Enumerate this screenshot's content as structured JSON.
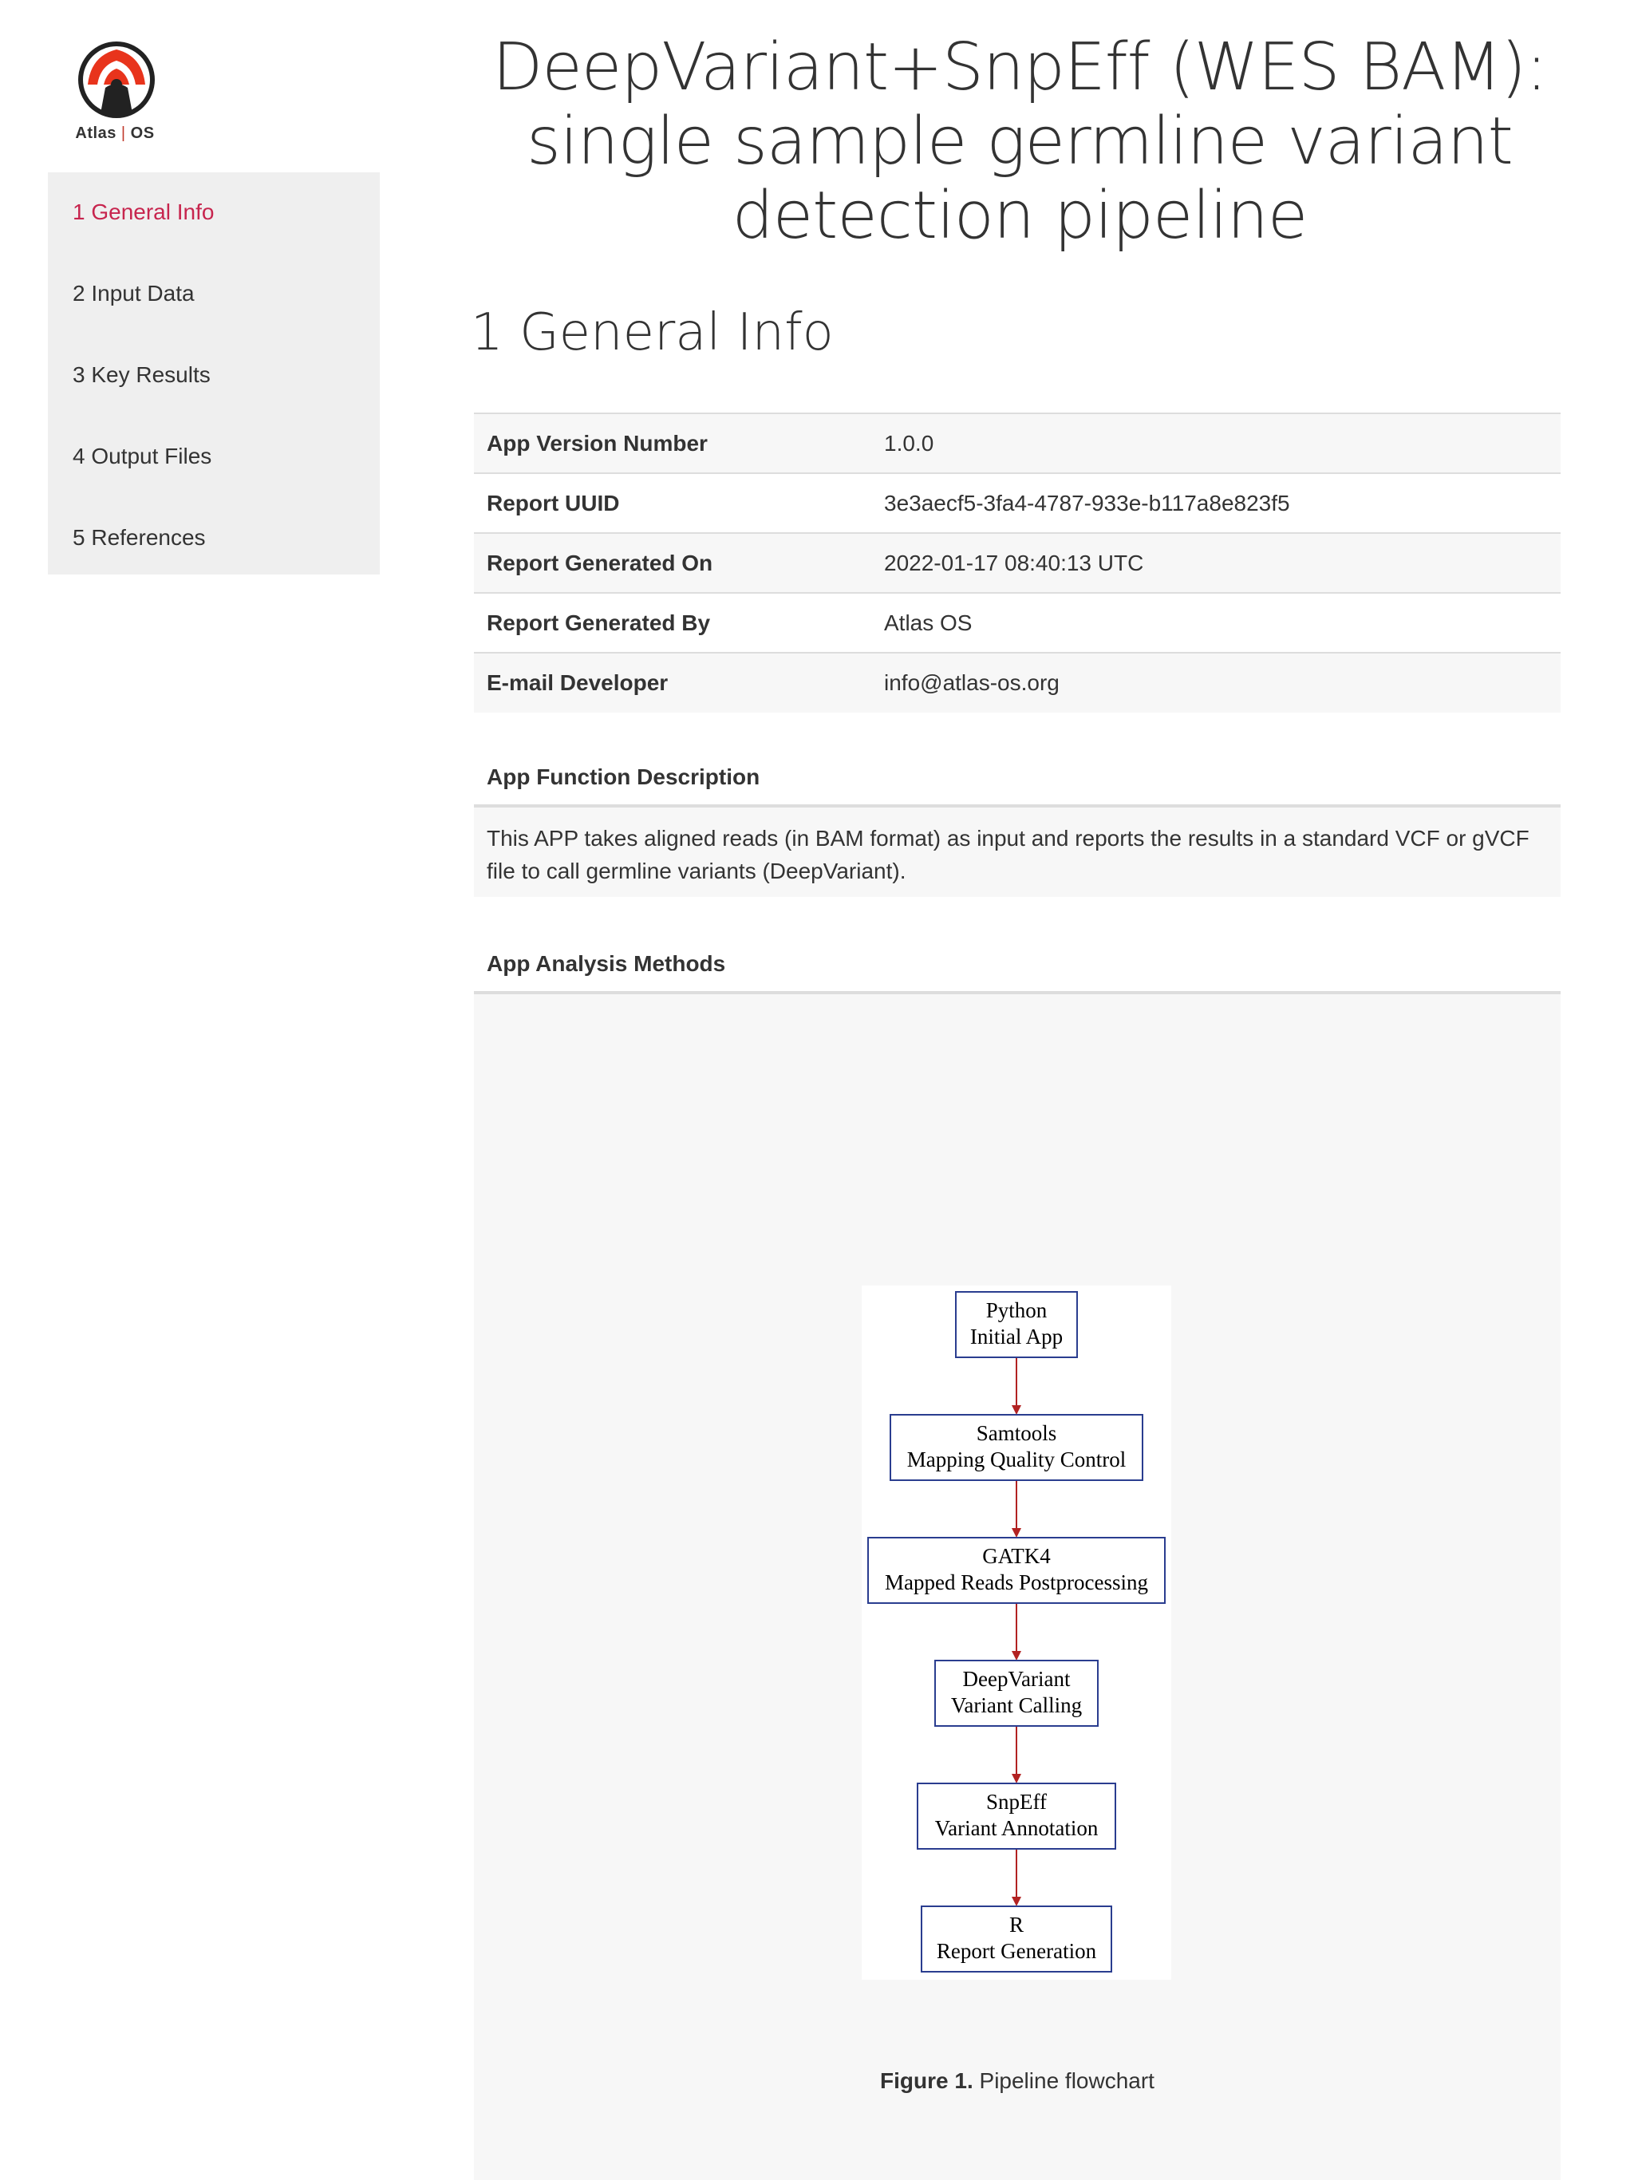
{
  "logo": {
    "brand": "Atlas",
    "separator": "|",
    "brand_suffix": "OS",
    "icon": "atlas-os-logo-icon",
    "colors": {
      "red": "#e8341c",
      "dark": "#222222"
    }
  },
  "sidebar": {
    "items": [
      {
        "label": "1 General Info",
        "active": true
      },
      {
        "label": "2 Input Data",
        "active": false
      },
      {
        "label": "3 Key Results",
        "active": false
      },
      {
        "label": "4 Output Files",
        "active": false
      },
      {
        "label": "5 References",
        "active": false
      }
    ]
  },
  "title": {
    "line1": "DeepVariant+SnpEff (WES BAM):",
    "line2": "single sample germline variant",
    "line3": "detection pipeline"
  },
  "section": {
    "title": "1 General Info"
  },
  "info_table": {
    "rows": [
      {
        "key": "App Version Number",
        "value": "1.0.0"
      },
      {
        "key": "Report UUID",
        "value": "3e3aecf5-3fa4-4787-933e-b117a8e823f5"
      },
      {
        "key": "Report Generated On",
        "value": "2022-01-17 08:40:13 UTC"
      },
      {
        "key": "Report Generated By",
        "value": "Atlas OS"
      },
      {
        "key": "E-mail Developer",
        "value": "info@atlas-os.org"
      }
    ]
  },
  "function_description": {
    "heading": "App Function Description",
    "text_line1": "This APP takes aligned reads (in BAM format) as input and reports the results in a standard VCF or gVCF",
    "text_line2": "file to call germline variants (DeepVariant)."
  },
  "analysis_methods": {
    "heading": "App Analysis Methods",
    "flowchart": {
      "edge_color": "#b22222",
      "box_color": "#2a3d8f",
      "nodes": [
        {
          "line1": "Python",
          "line2": "Initial App"
        },
        {
          "line1": "Samtools",
          "line2": "Mapping Quality Control"
        },
        {
          "line1": "GATK4",
          "line2": "Mapped Reads Postprocessing"
        },
        {
          "line1": "DeepVariant",
          "line2": "Variant Calling"
        },
        {
          "line1": "SnpEff",
          "line2": "Variant Annotation"
        },
        {
          "line1": "R",
          "line2": "Report Generation"
        }
      ]
    },
    "caption_label": "Figure 1.",
    "caption_text": "Pipeline flowchart"
  }
}
